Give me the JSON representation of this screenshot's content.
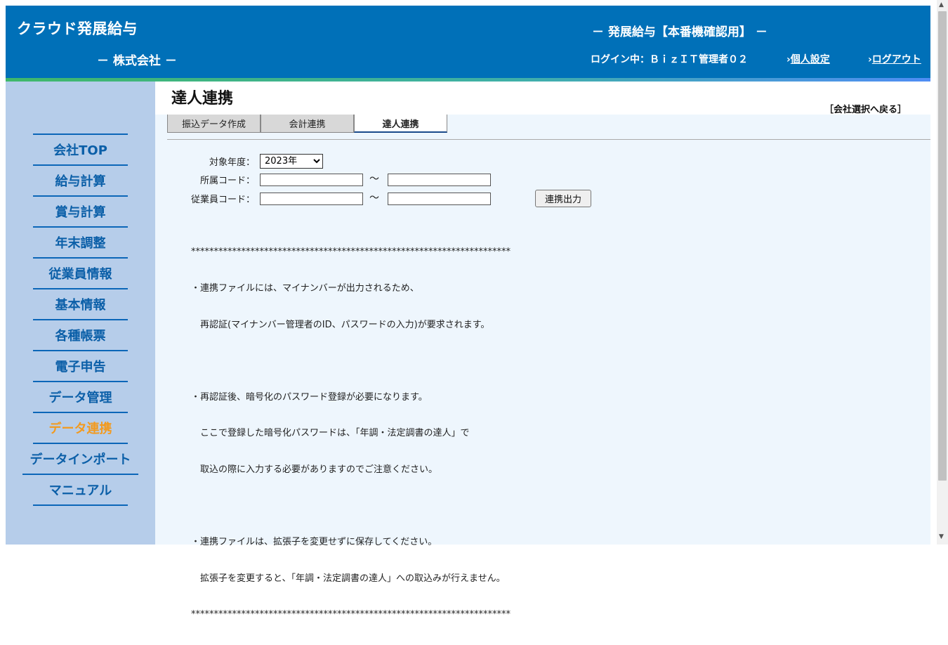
{
  "header": {
    "app_logo": "クラウド発展給与",
    "company_name": "－ 株式会社 －",
    "environment_title": "－ 発展給与【本番機確認用】 －",
    "login_status": "ログイン中：ＢｉｚＩＴ管理者０２",
    "personal_settings": "個人設定",
    "logout": "ログアウト",
    "link_arrow": "›"
  },
  "sidebar": {
    "items": [
      {
        "label": "会社TOP"
      },
      {
        "label": "給与計算"
      },
      {
        "label": "賞与計算"
      },
      {
        "label": "年末調整"
      },
      {
        "label": "従業員情報"
      },
      {
        "label": "基本情報"
      },
      {
        "label": "各種帳票"
      },
      {
        "label": "電子申告"
      },
      {
        "label": "データ管理"
      },
      {
        "label": "データ連携"
      },
      {
        "label": "データインポート"
      },
      {
        "label": "マニュアル"
      }
    ],
    "active": "データ連携"
  },
  "main": {
    "title": "達人連携",
    "back_link": "［会社選択へ戻る］",
    "tabs": [
      {
        "label": "振込データ作成"
      },
      {
        "label": "会計連携"
      },
      {
        "label": "達人連携"
      }
    ],
    "active_tab": "達人連携",
    "form": {
      "year_label": "対象年度：",
      "year_value": "2023年",
      "dept_label": "所属コード：",
      "dept_from": "",
      "dept_to": "",
      "emp_label": "従業員コード：",
      "emp_from": "",
      "emp_to": "",
      "range_separator": "～",
      "export_button": "連携出力"
    },
    "notice_lines": [
      "**********************************************************************",
      "・連携ファイルには、マイナンバーが出力されるため、",
      "　再認証(マイナンバー管理者のID、パスワードの入力)が要求されます。",
      "",
      "・再認証後、暗号化のパスワード登録が必要になります。",
      "　ここで登録した暗号化パスワードは、「年調・法定調書の達人」で",
      "　取込の際に入力する必要がありますのでご注意ください。",
      "",
      "・連携ファイルは、拡張子を変更せずに保存してください。",
      "　拡張子を変更すると、「年調・法定調書の達人」への取込みが行えません。",
      "**********************************************************************"
    ]
  },
  "colors": {
    "header_bg": "#0070b8",
    "sidebar_bg": "#b6cdea",
    "nav_text": "#0b5fa8",
    "nav_active": "#f39a1e",
    "content_bg": "#eef6fd"
  }
}
